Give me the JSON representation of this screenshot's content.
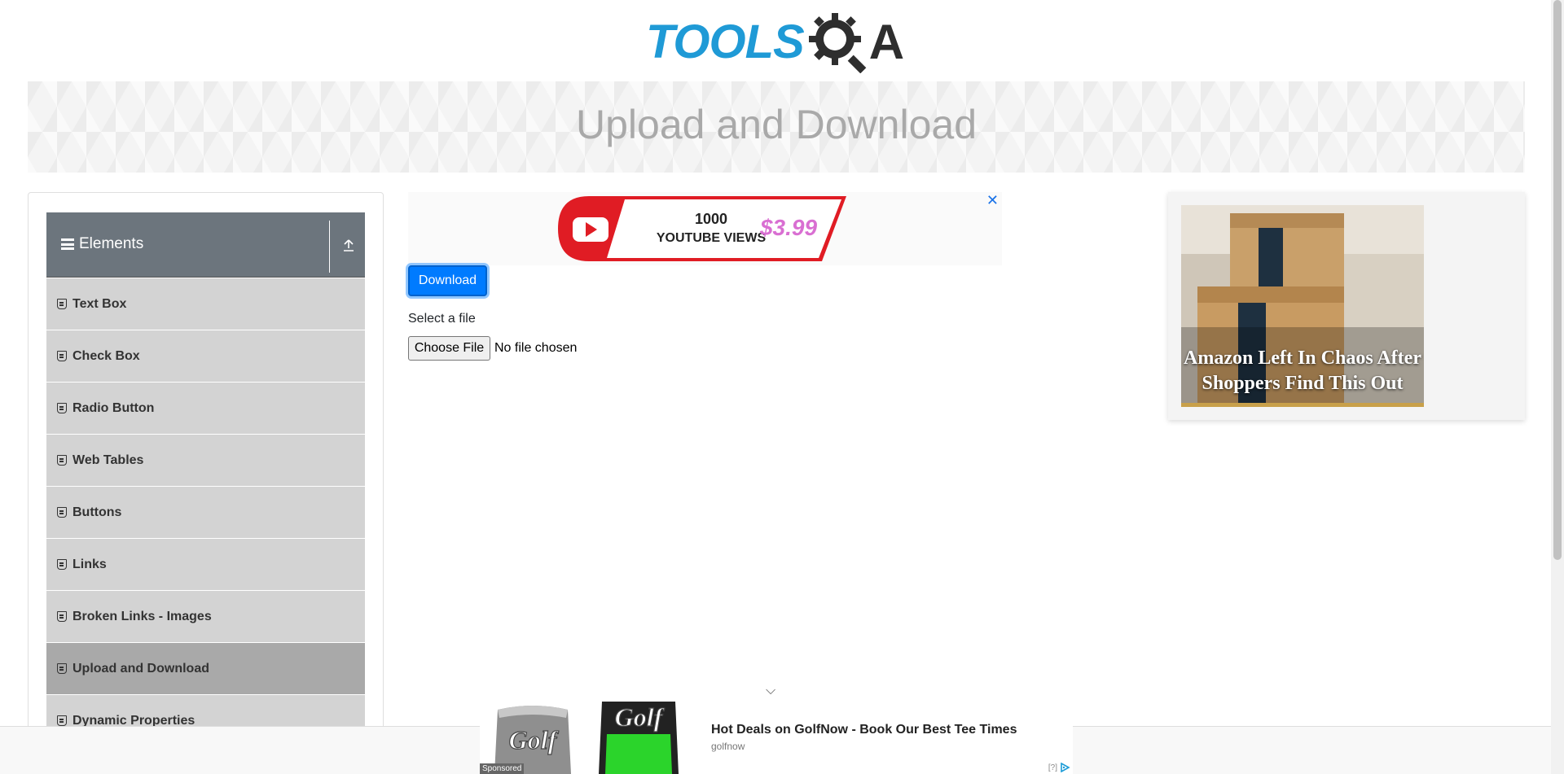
{
  "header": {
    "logo_main": "TOOLS",
    "logo_suffix": "A"
  },
  "banner": {
    "title": "Upload and Download"
  },
  "sidebar": {
    "group_title": "Elements",
    "items": [
      {
        "label": "Text Box"
      },
      {
        "label": "Check Box"
      },
      {
        "label": "Radio Button"
      },
      {
        "label": "Web Tables"
      },
      {
        "label": "Buttons"
      },
      {
        "label": "Links"
      },
      {
        "label": "Broken Links - Images"
      },
      {
        "label": "Upload and Download",
        "active": true
      },
      {
        "label": "Dynamic Properties"
      }
    ]
  },
  "main": {
    "ad_close": "✕",
    "yt_ad_count": "1000",
    "yt_ad_text": "YOUTUBE VIEWS",
    "yt_ad_price": "$3.99",
    "download_label": "Download",
    "select_label": "Select a file",
    "choose_file_label": "Choose File",
    "file_status": "No file chosen"
  },
  "right_ad": {
    "caption": "Amazon Left In Chaos After Shoppers Find This Out"
  },
  "bottom_ad": {
    "sponsored": "Sponsored",
    "title": "Hot Deals on GolfNow - Book Our Best Tee Times",
    "source": "golfnow",
    "help": "[?]",
    "can_text": "Golf"
  },
  "colors": {
    "brand_blue": "#1f9ad6",
    "primary_button": "#007bff",
    "sidebar_header": "#6c757d",
    "menu_item": "#d3d3d3",
    "menu_item_active": "#a9a9a9"
  },
  "icons": {
    "menu": "hamburger-icon",
    "toggle": "upload-arrow-icon",
    "item": "file-icon",
    "close": "close-icon",
    "chevron": "chevron-down-icon",
    "adchoices": "adchoices-icon"
  }
}
